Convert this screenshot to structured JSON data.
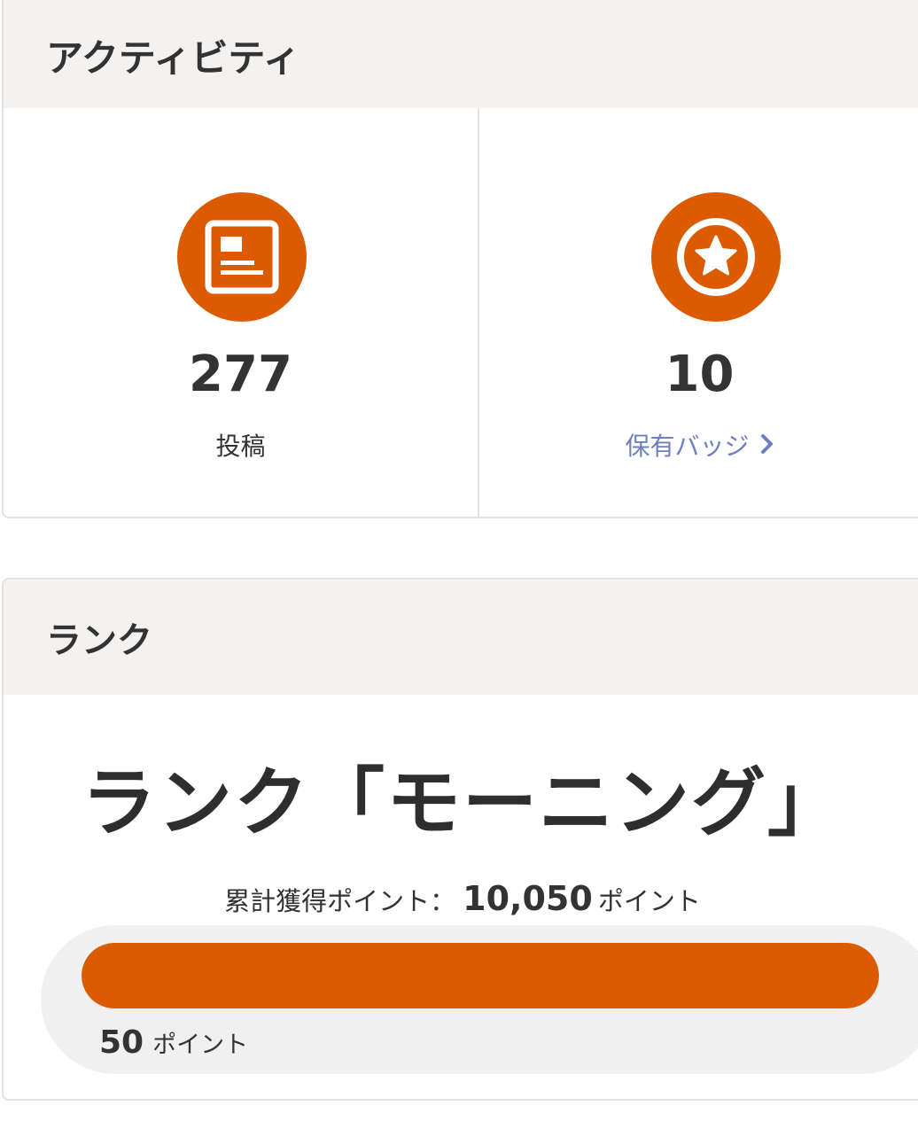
{
  "activity": {
    "title": "アクティビティ",
    "posts": {
      "count": "277",
      "label": "投稿",
      "icon": "article-icon"
    },
    "badges": {
      "count": "10",
      "label": "保有バッジ",
      "icon": "star-badge-icon"
    }
  },
  "rank": {
    "title": "ランク",
    "rank_name": "ランク「モーニング」",
    "total_label": "累計獲得ポイント：",
    "total_value": "10,050",
    "total_unit": "ポイント",
    "progress_fraction": 1.0,
    "progress_value": "50",
    "progress_unit": "ポイント"
  },
  "colors": {
    "accent": "#dc5a00",
    "link": "#6e7fc0",
    "header_bg": "#f3f2f1"
  }
}
